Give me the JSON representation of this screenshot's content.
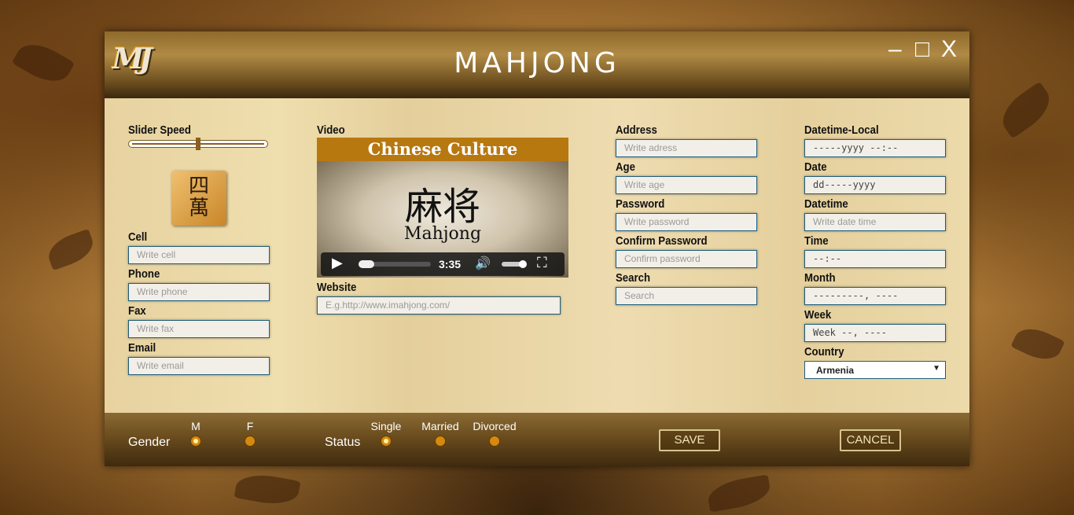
{
  "app": {
    "title": "MAHJONG",
    "logo_text": "MJ",
    "minimize": "–",
    "maximize": "□",
    "close": "X"
  },
  "col1": {
    "slider_label": "Slider Speed",
    "slider_value": 0.5,
    "tile_chars": "四\n萬",
    "cell_label": "Cell",
    "cell_placeholder": "Write cell",
    "phone_label": "Phone",
    "phone_placeholder": "Write phone",
    "fax_label": "Fax",
    "fax_placeholder": "Write fax",
    "email_label": "Email",
    "email_placeholder": "Write email"
  },
  "col2": {
    "video_label": "Video",
    "video_title": "Chinese Culture",
    "video_chars": "麻将",
    "video_sub": "Mahjong",
    "video_time": "3:35",
    "website_label": "Website",
    "website_placeholder": "E.g.http://www.imahjong.com/"
  },
  "col3": {
    "address_label": "Address",
    "address_placeholder": "Write adress",
    "age_label": "Age",
    "age_placeholder": "Write age",
    "password_label": "Password",
    "password_placeholder": "Write password",
    "confirm_label": "Confirm Password",
    "confirm_placeholder": "Confirm password",
    "search_label": "Search",
    "search_placeholder": "Search"
  },
  "col4": {
    "datetime_local_label": "Datetime-Local",
    "datetime_local_value": "-----yyyy --:--",
    "date_label": "Date",
    "date_value": "dd-----yyyy",
    "datetime_label": "Datetime",
    "datetime_placeholder": "Write date time",
    "time_label": "Time",
    "time_value": "--:--",
    "month_label": "Month",
    "month_value": "---------, ----",
    "week_label": "Week",
    "week_value": "Week --, ----",
    "country_label": "Country",
    "country_value": "Armenia"
  },
  "footer": {
    "gender_label": "Gender",
    "gender_m": "M",
    "gender_f": "F",
    "status_label": "Status",
    "status_single": "Single",
    "status_married": "Married",
    "status_divorced": "Divorced",
    "save_label": "SAVE",
    "cancel_label": "CANCEL"
  },
  "colors": {
    "accent": "#d48a10",
    "field_border": "#1d5d7a",
    "header_brown": "#8e6a2c"
  }
}
